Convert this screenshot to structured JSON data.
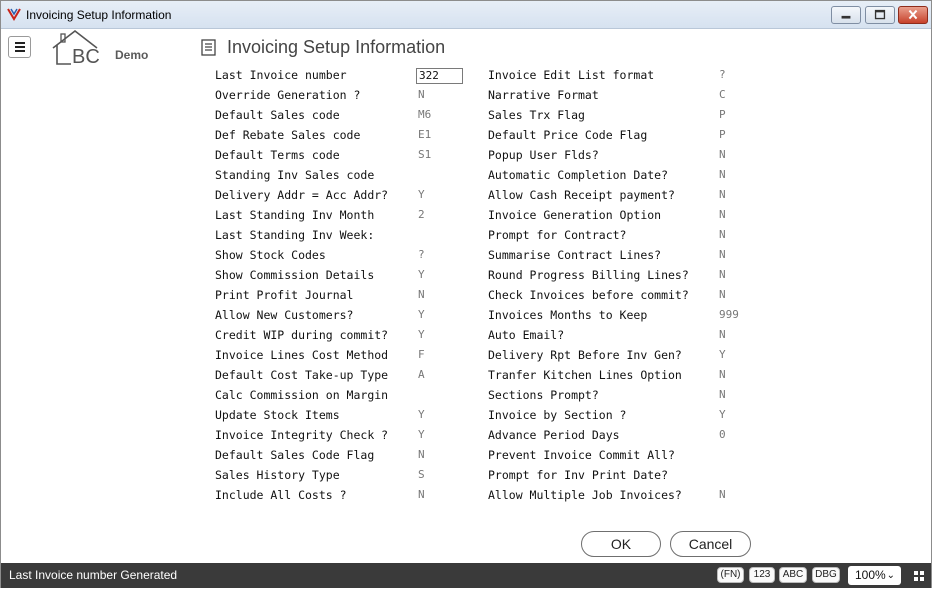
{
  "window": {
    "title": "Invoicing Setup Information"
  },
  "header": {
    "logo_text": "BC",
    "logo_demo": "Demo",
    "page_title": "Invoicing Setup Information"
  },
  "left_fields": [
    {
      "label": "Last Invoice number",
      "value": "322",
      "is_input": true
    },
    {
      "label": "Override Generation ?",
      "value": "N"
    },
    {
      "label": "Default Sales code",
      "value": "M6"
    },
    {
      "label": "Def Rebate Sales code",
      "value": "E1"
    },
    {
      "label": "Default Terms code",
      "value": "S1"
    },
    {
      "label": "Standing Inv Sales code",
      "value": ""
    },
    {
      "label": "Delivery Addr = Acc Addr?",
      "value": "Y"
    },
    {
      "label": "Last Standing Inv Month",
      "value": "2"
    },
    {
      "label": "Last Standing Inv Week:",
      "value": ""
    },
    {
      "label": "Show Stock Codes",
      "value": "?"
    },
    {
      "label": "Show Commission Details",
      "value": "Y"
    },
    {
      "label": "Print Profit Journal",
      "value": "N"
    },
    {
      "label": "Allow New Customers?",
      "value": "Y"
    },
    {
      "label": "Credit WIP during commit?",
      "value": "Y"
    },
    {
      "label": "Invoice Lines Cost Method",
      "value": "F"
    },
    {
      "label": "Default Cost Take-up Type",
      "value": "A"
    },
    {
      "label": "Calc Commission on Margin",
      "value": ""
    },
    {
      "label": "Update Stock Items",
      "value": "Y"
    },
    {
      "label": "Invoice Integrity Check ?",
      "value": "Y"
    },
    {
      "label": "Default Sales Code Flag",
      "value": "N"
    },
    {
      "label": "Sales History Type",
      "value": "S"
    },
    {
      "label": "Include All Costs ?",
      "value": "N"
    }
  ],
  "right_fields": [
    {
      "label": "Invoice Edit List format",
      "value": "?"
    },
    {
      "label": "Narrative Format",
      "value": "C"
    },
    {
      "label": "Sales Trx Flag",
      "value": "P"
    },
    {
      "label": "Default Price Code Flag",
      "value": "P"
    },
    {
      "label": "Popup User Flds?",
      "value": "N"
    },
    {
      "label": "Automatic Completion Date?",
      "value": "N"
    },
    {
      "label": "Allow Cash Receipt payment?",
      "value": "N"
    },
    {
      "label": "Invoice Generation Option",
      "value": "N"
    },
    {
      "label": "Prompt for Contract?",
      "value": "N"
    },
    {
      "label": "Summarise Contract Lines?",
      "value": "N"
    },
    {
      "label": "Round Progress Billing Lines?",
      "value": "N"
    },
    {
      "label": "Check Invoices before commit?",
      "value": "N"
    },
    {
      "label": "Invoices Months to Keep",
      "value": "999"
    },
    {
      "label": "Auto Email?",
      "value": "N"
    },
    {
      "label": "Delivery Rpt Before Inv Gen?",
      "value": "Y"
    },
    {
      "label": "Tranfer Kitchen Lines Option",
      "value": "N"
    },
    {
      "label": "Sections Prompt?",
      "value": "N"
    },
    {
      "label": "Invoice by Section ?",
      "value": "Y"
    },
    {
      "label": "Advance Period Days",
      "value": "0"
    },
    {
      "label": "Prevent Invoice Commit All?",
      "value": ""
    },
    {
      "label": "Prompt for Inv Print Date?",
      "value": ""
    },
    {
      "label": "Allow Multiple Job Invoices?",
      "value": "N"
    }
  ],
  "buttons": {
    "ok": "OK",
    "cancel": "Cancel"
  },
  "statusbar": {
    "text": "Last Invoice number Generated",
    "chips": {
      "fn": "(FN)",
      "num": "123",
      "abc": "ABC",
      "dbg": "DBG"
    },
    "zoom": "100%"
  },
  "icons": {
    "app": "app-logo-icon",
    "menu": "hamburger-icon",
    "page": "document-icon",
    "grid": "grid-icon",
    "zoom_dropdown": "chevron-down-icon"
  },
  "colors": {
    "accent": "#c8261b",
    "statusbar": "#3a3a3a",
    "titlebar": "#dbe5f1"
  }
}
